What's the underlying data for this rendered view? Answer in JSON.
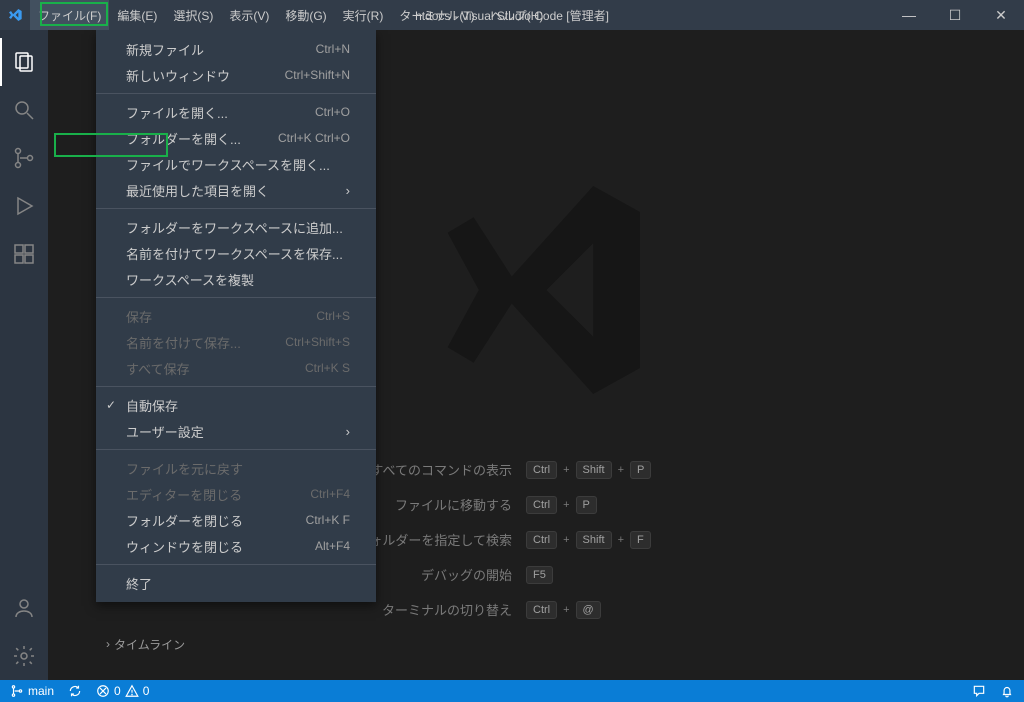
{
  "title": "htdocs - Visual Studio Code [管理者]",
  "menubar": {
    "file": "ファイル(F)",
    "edit": "編集(E)",
    "selection": "選択(S)",
    "view": "表示(V)",
    "go": "移動(G)",
    "run": "実行(R)",
    "terminal": "ターミナル(T)",
    "help": "ヘルプ(H)"
  },
  "fileMenu": {
    "newFile": {
      "label": "新規ファイル",
      "shortcut": "Ctrl+N"
    },
    "newWindow": {
      "label": "新しいウィンドウ",
      "shortcut": "Ctrl+Shift+N"
    },
    "openFile": {
      "label": "ファイルを開く...",
      "shortcut": "Ctrl+O"
    },
    "openFolder": {
      "label": "フォルダーを開く...",
      "shortcut": "Ctrl+K Ctrl+O"
    },
    "openWorkspace": {
      "label": "ファイルでワークスペースを開く..."
    },
    "openRecent": {
      "label": "最近使用した項目を開く"
    },
    "addFolderToWorkspace": {
      "label": "フォルダーをワークスペースに追加..."
    },
    "saveWorkspaceAs": {
      "label": "名前を付けてワークスペースを保存..."
    },
    "duplicateWorkspace": {
      "label": "ワークスペースを複製"
    },
    "save": {
      "label": "保存",
      "shortcut": "Ctrl+S"
    },
    "saveAs": {
      "label": "名前を付けて保存...",
      "shortcut": "Ctrl+Shift+S"
    },
    "saveAll": {
      "label": "すべて保存",
      "shortcut": "Ctrl+K S"
    },
    "autoSave": {
      "label": "自動保存"
    },
    "preferences": {
      "label": "ユーザー設定"
    },
    "revertFile": {
      "label": "ファイルを元に戻す"
    },
    "closeEditor": {
      "label": "エディターを閉じる",
      "shortcut": "Ctrl+F4"
    },
    "closeFolder": {
      "label": "フォルダーを閉じる",
      "shortcut": "Ctrl+K F"
    },
    "closeWindow": {
      "label": "ウィンドウを閉じる",
      "shortcut": "Alt+F4"
    },
    "exit": {
      "label": "終了"
    }
  },
  "welcome": {
    "showAllCommands": {
      "label": "すべてのコマンドの表示",
      "keys": [
        "Ctrl",
        "Shift",
        "P"
      ]
    },
    "goToFile": {
      "label": "ファイルに移動する",
      "keys": [
        "Ctrl",
        "P"
      ]
    },
    "findInFolder": {
      "label": "フォルダーを指定して検索",
      "keys": [
        "Ctrl",
        "Shift",
        "F"
      ]
    },
    "startDebugging": {
      "label": "デバッグの開始",
      "keys": [
        "F5"
      ]
    },
    "toggleTerminal": {
      "label": "ターミナルの切り替え",
      "keys": [
        "Ctrl",
        "@"
      ]
    }
  },
  "sidebar_sections": {
    "timeline": "タイムライン"
  },
  "statusbar": {
    "branch": "main",
    "errors": "0",
    "warnings": "0"
  }
}
